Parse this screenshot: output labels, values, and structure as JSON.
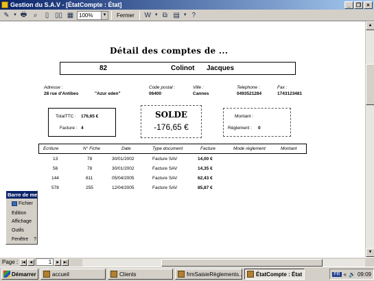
{
  "window": {
    "title": "Gestion du S.A.V - [ÉtatCompte : État]"
  },
  "toolbar": {
    "zoom_value": "100%",
    "close_label": "Fermer"
  },
  "report": {
    "title": "Détail des comptes de ...",
    "client_id": "82",
    "last_name": "Colinot",
    "first_name": "Jacques",
    "labels": {
      "address": "Adresse :",
      "postal_code": "Code postal :",
      "city": "Ville :",
      "phone": "Telephone :",
      "fax": "Fax :"
    },
    "address_line": "28 rue d'Antibes",
    "address_name": "\"Azur eden\"",
    "postal_code": "06400",
    "city": "Cannes",
    "phone": "0493521284",
    "fax": "1743123481",
    "total_ttc_label": "TotalTTC :",
    "total_ttc_value": "176,65 €",
    "facture_label": "Facture :",
    "facture_value": "4",
    "solde_title": "SOLDE",
    "solde_value": "-176,65 €",
    "montant_label": "Montant :",
    "montant_value": "",
    "reglement_label": "Règlement :",
    "reglement_value": "0",
    "columns": [
      "Ecriture",
      "N° Fiche",
      "Date",
      "Type document",
      "Facture",
      "Mode règlement",
      "Montant"
    ],
    "rows": [
      {
        "ecriture": "13",
        "fiche": "78",
        "date": "30/01/2002",
        "type": "Facture SAV",
        "facture": "14,00 €"
      },
      {
        "ecriture": "56",
        "fiche": "78",
        "date": "30/01/2002",
        "type": "Facture SAV",
        "facture": "14,35 €"
      },
      {
        "ecriture": "144",
        "fiche": "811",
        "date": "05/04/2005",
        "type": "Facture SAV",
        "facture": "62,43 €"
      },
      {
        "ecriture": "578",
        "fiche": "255",
        "date": "12/04/2005",
        "type": "Facture SAV",
        "facture": "85,87 €"
      }
    ]
  },
  "menu_window": {
    "title": "Barre de me",
    "items": [
      "Fichier",
      "Edition",
      "Affichage",
      "Outils",
      "Fenêtre",
      "?"
    ]
  },
  "navigation": {
    "page_label": "Page :",
    "page_value": "1"
  },
  "taskbar": {
    "start_label": "Démarrer",
    "tasks": [
      "accueil",
      "Clients",
      "frmSaisieRèglements...",
      "ÉtatCompte : État"
    ],
    "lang": "FR",
    "clock": "09:09"
  }
}
